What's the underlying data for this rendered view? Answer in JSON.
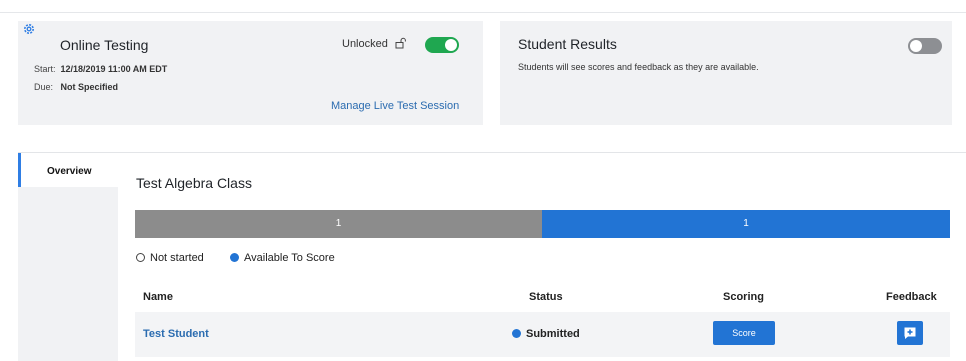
{
  "online_testing": {
    "title": "Online Testing",
    "start_label": "Start:",
    "start_value": "12/18/2019 11:00 AM EDT",
    "due_label": "Due:",
    "due_value": "Not Specified",
    "lock_status": "Unlocked",
    "toggle_on": true,
    "manage_link": "Manage Live Test Session"
  },
  "student_results": {
    "title": "Student Results",
    "description": "Students will see scores and feedback as they are available.",
    "toggle_on": false
  },
  "sidebar": {
    "tabs": [
      {
        "label": "Overview",
        "active": true
      }
    ]
  },
  "main": {
    "class_title": "Test Algebra Class",
    "progress": [
      {
        "label": "Not started",
        "count": "1",
        "color": "#8c8c8c"
      },
      {
        "label": "Available To Score",
        "count": "1",
        "color": "#2274d4"
      }
    ],
    "legend": [
      {
        "label": "Not started"
      },
      {
        "label": "Available To Score"
      }
    ],
    "table": {
      "headers": [
        "Name",
        "Status",
        "Scoring",
        "Feedback"
      ],
      "rows": [
        {
          "name": "Test Student",
          "status": "Submitted",
          "scoring_button": "Score"
        }
      ]
    }
  },
  "colors": {
    "accent": "#2274d4",
    "toggle_on": "#1fa750",
    "link": "#2b6cb0"
  }
}
